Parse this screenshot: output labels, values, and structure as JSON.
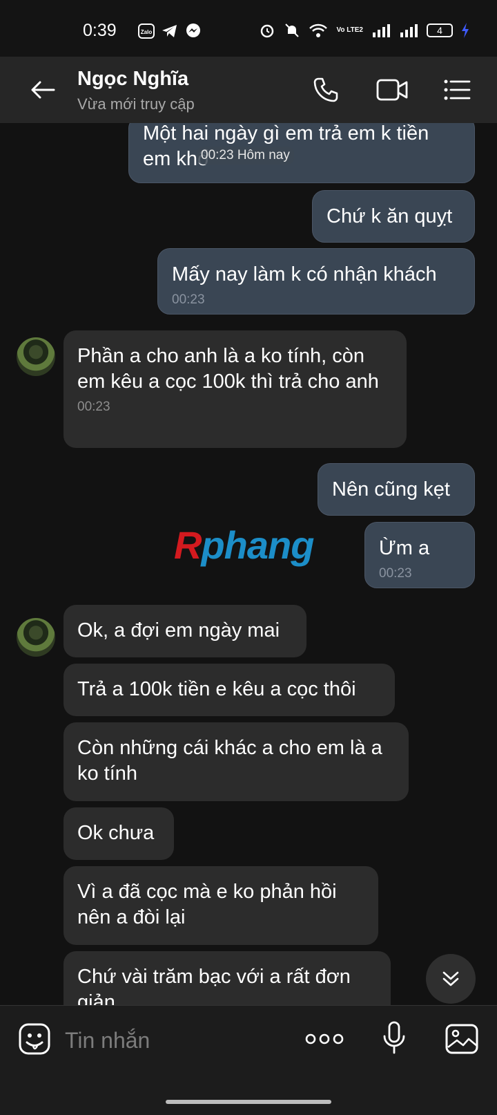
{
  "status_bar": {
    "time": "0:39",
    "zalo_label": "Zalo",
    "battery": "4",
    "volte": "Vo LTE2"
  },
  "header": {
    "name": "Ngọc Nghĩa",
    "status": "Vừa mới truy cập"
  },
  "floating_time": "00:23 Hôm nay",
  "messages": [
    {
      "direction": "out",
      "text": "Một hai ngày gì em trả em k tiền em khổ",
      "time": ""
    },
    {
      "direction": "out",
      "text": "Chứ k ăn quỵt",
      "time": ""
    },
    {
      "direction": "out",
      "text": "Mấy nay làm k có nhận khách",
      "time": "00:23"
    },
    {
      "direction": "in",
      "text": "Phần a cho anh là a ko tính, còn em kêu a cọc 100k thì trả cho anh",
      "time": "00:23"
    },
    {
      "direction": "out",
      "text": "Nên cũng kẹt",
      "time": ""
    },
    {
      "direction": "out",
      "text": "Ừm a",
      "time": "00:23"
    },
    {
      "direction": "in",
      "text": "Ok, a đợi em ngày mai",
      "time": ""
    },
    {
      "direction": "in",
      "text": "Trả a 100k tiền e kêu a cọc thôi",
      "time": ""
    },
    {
      "direction": "in",
      "text": "Còn những cái khác a cho em là a ko tính",
      "time": ""
    },
    {
      "direction": "in",
      "text": "Ok chưa",
      "time": ""
    },
    {
      "direction": "in",
      "text": "Vì a đã cọc mà e ko phản hồi nên a đòi lại",
      "time": ""
    },
    {
      "direction": "in",
      "text": "Chứ vài trăm bạc với a rất đơn giản",
      "time": ""
    }
  ],
  "watermark": {
    "first": "R",
    "rest": "phang"
  },
  "input": {
    "placeholder": "Tin nhắn"
  },
  "icons": {
    "back": "arrow-left-icon",
    "call": "phone-icon",
    "video": "video-camera-icon",
    "menu": "list-menu-icon",
    "sticker": "sticker-icon",
    "more": "more-dots-icon",
    "mic": "microphone-icon",
    "image": "image-icon",
    "scroll": "chevron-double-down-icon"
  },
  "colors": {
    "outgoing": "#3a4654",
    "incoming": "#2c2c2c",
    "background": "#121212"
  }
}
